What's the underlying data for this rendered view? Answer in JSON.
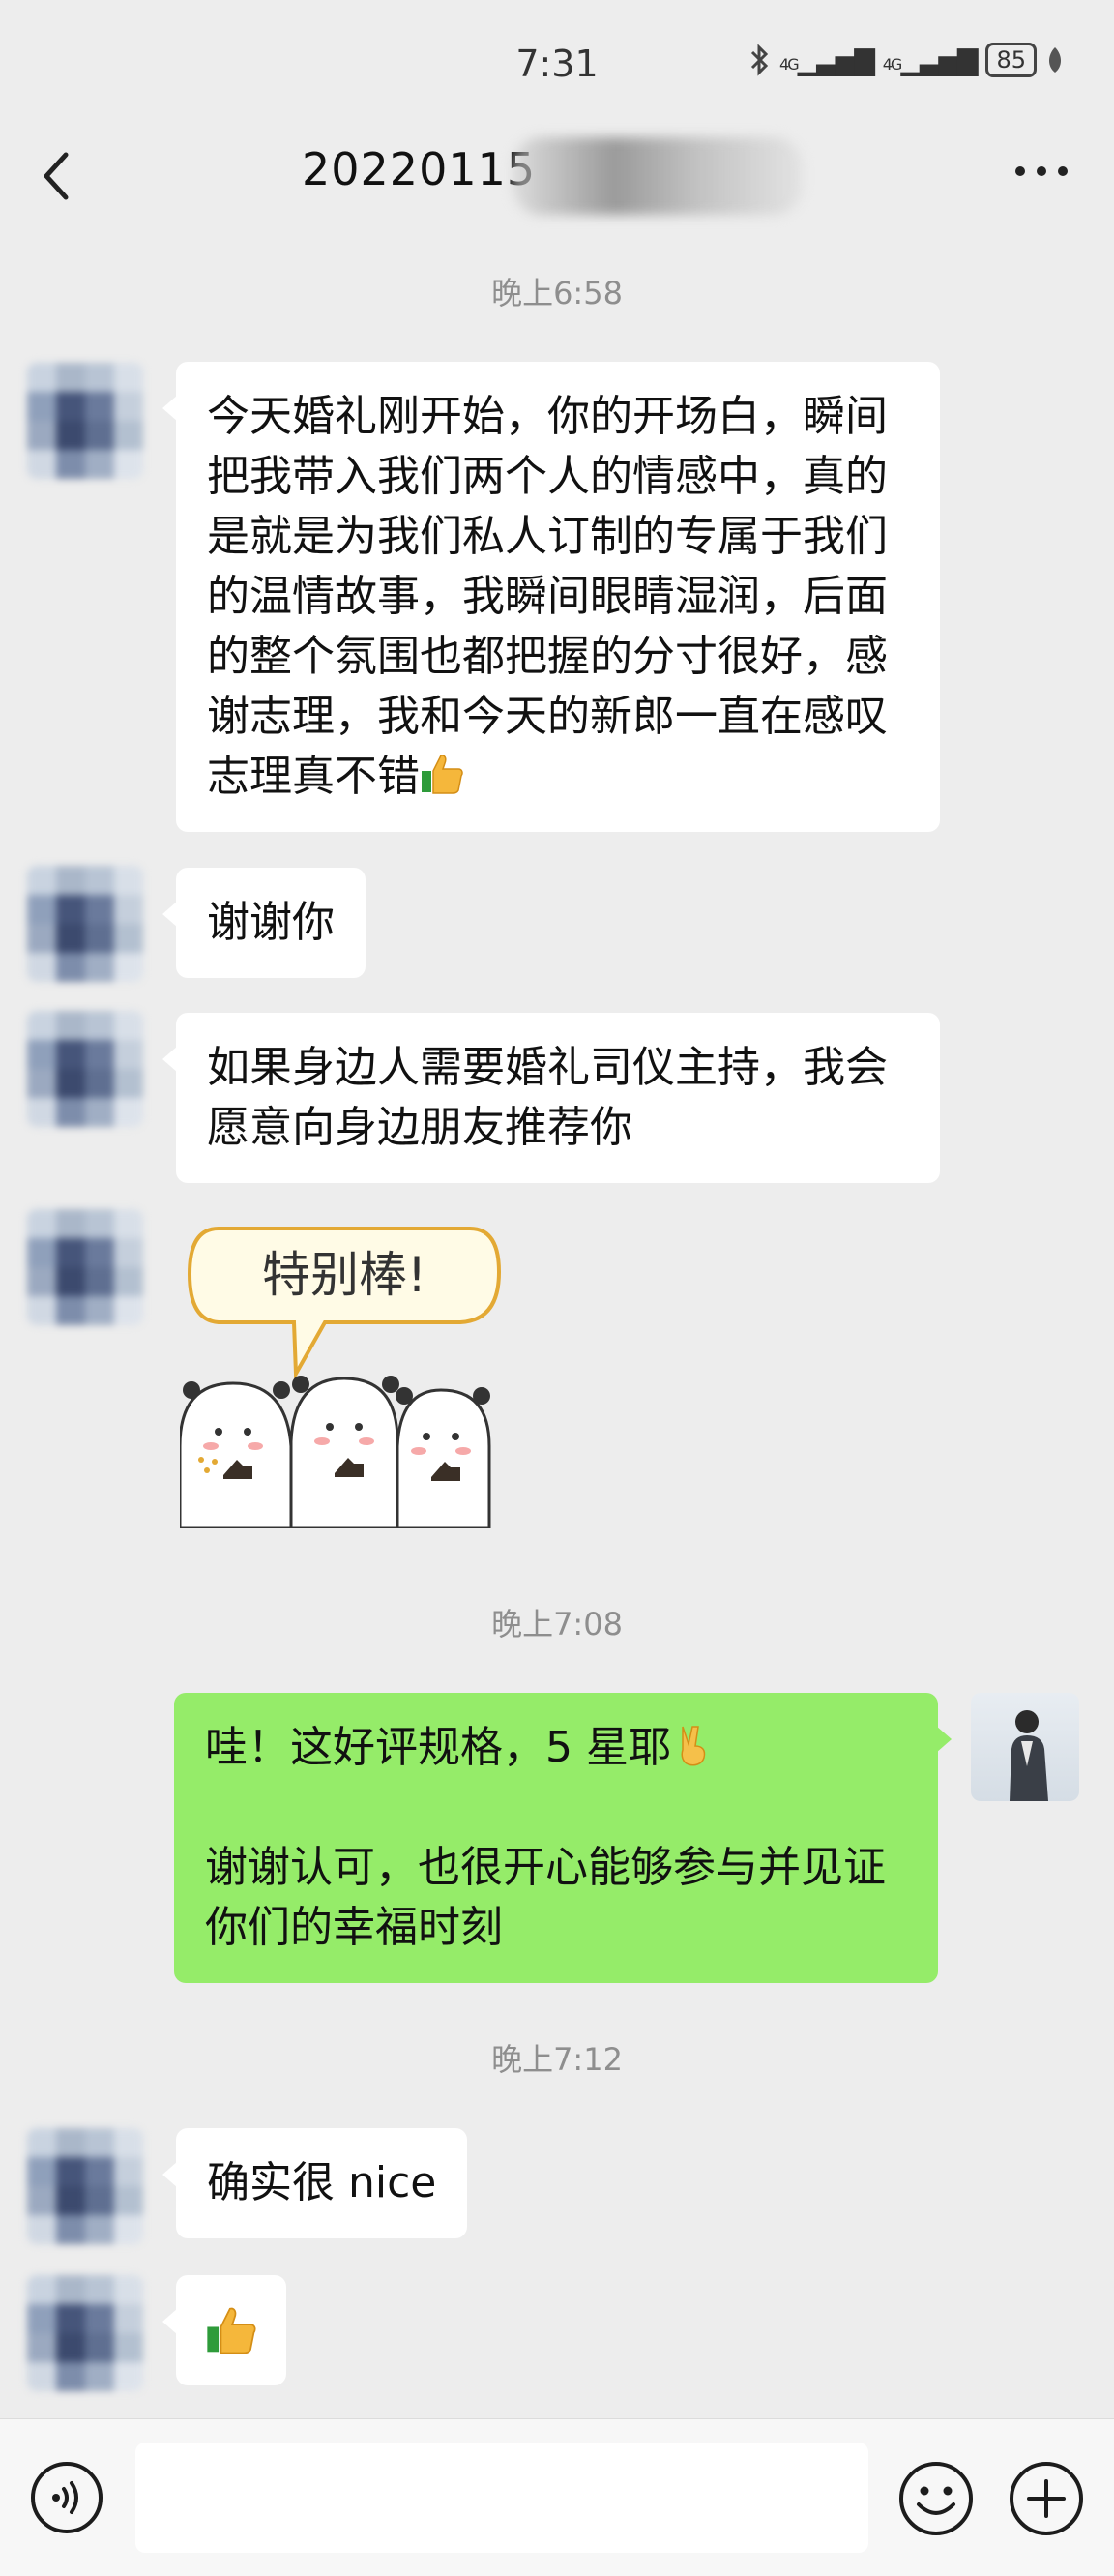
{
  "status_bar": {
    "time": "7:31",
    "signal1": "4G",
    "signal2": "4G",
    "battery": "85"
  },
  "header": {
    "title": "20220115"
  },
  "timestamps": [
    "晚上6:58",
    "晚上7:08",
    "晚上7:12"
  ],
  "messages": {
    "m1": "今天婚礼刚开始，你的开场白，瞬间把我带入我们两个人的情感中，真的是就是为我们私人订制的专属于我们的温情故事，我瞬间眼睛湿润，后面的整个氛围也都把握的分寸很好，感谢志理，我和今天的新郎一直在感叹志理真不错",
    "m2": "谢谢你",
    "m3": "如果身边人需要婚礼司仪主持，我会愿意向身边朋友推荐你",
    "sticker_text": "特别棒!",
    "m5_line1": "哇！这好评规格，5 星耶",
    "m5_line2": "谢谢认可，也很开心能够参与并见证你们的幸福时刻",
    "m6": "确实很 nice"
  },
  "input": {
    "placeholder": "",
    "value": ""
  },
  "colors": {
    "outgoing_bubble": "#95ec69",
    "incoming_bubble": "#ffffff",
    "background": "#ededed"
  },
  "icons": [
    "back-arrow-icon",
    "more-icon",
    "voice-icon",
    "emoji-icon",
    "plus-icon",
    "thumbs-up-icon",
    "victory-hand-icon"
  ]
}
